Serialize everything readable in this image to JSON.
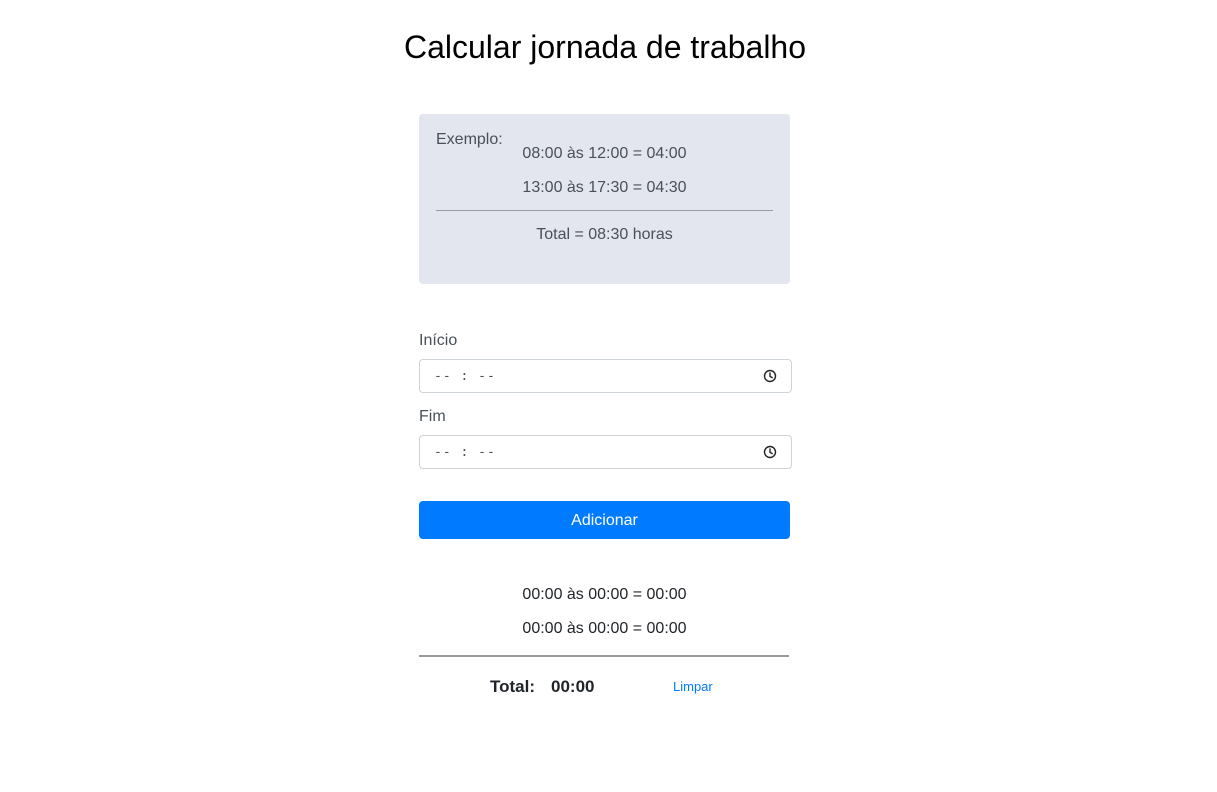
{
  "page": {
    "title": "Calcular jornada de trabalho"
  },
  "example": {
    "label": "Exemplo:",
    "lines": [
      "08:00 às 12:00 = 04:00",
      "13:00 às 17:30 = 04:30"
    ],
    "total": "Total = 08:30 horas"
  },
  "form": {
    "start_label": "Início",
    "start_placeholder": "-- : --",
    "end_label": "Fim",
    "end_placeholder": "-- : --",
    "add_label": "Adicionar"
  },
  "results": {
    "lines": [
      "00:00 às 00:00 = 00:00",
      "00:00 às 00:00 = 00:00"
    ],
    "total_label": "Total:",
    "total_value": "00:00",
    "clear_label": "Limpar"
  },
  "colors": {
    "accent": "#007bff",
    "example_bg": "#e3e6ef"
  },
  "icons": {
    "time_picker": "clock-icon"
  }
}
